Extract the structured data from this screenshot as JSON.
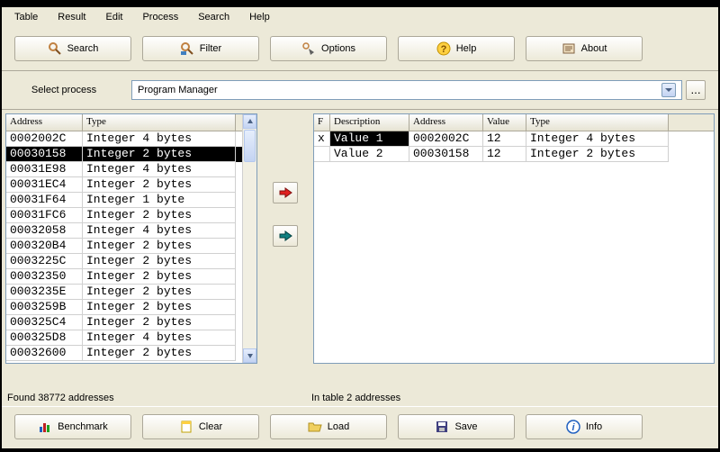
{
  "menu": [
    "Table",
    "Result",
    "Edit",
    "Process",
    "Search",
    "Help"
  ],
  "toolbar": {
    "search": "Search",
    "filter": "Filter",
    "options": "Options",
    "help": "Help",
    "about": "About"
  },
  "process": {
    "label": "Select process",
    "value": "Program Manager",
    "browse": "..."
  },
  "left_grid": {
    "headers": {
      "address": "Address",
      "type": "Type"
    },
    "rows": [
      {
        "addr": "0002002C",
        "type": "Integer 4 bytes",
        "sel": false
      },
      {
        "addr": "00030158",
        "type": "Integer 2 bytes",
        "sel": true
      },
      {
        "addr": "00031E98",
        "type": "Integer 4 bytes",
        "sel": false
      },
      {
        "addr": "00031EC4",
        "type": "Integer 2 bytes",
        "sel": false
      },
      {
        "addr": "00031F64",
        "type": "Integer 1 byte",
        "sel": false
      },
      {
        "addr": "00031FC6",
        "type": "Integer 2 bytes",
        "sel": false
      },
      {
        "addr": "00032058",
        "type": "Integer 4 bytes",
        "sel": false
      },
      {
        "addr": "000320B4",
        "type": "Integer 2 bytes",
        "sel": false
      },
      {
        "addr": "0003225C",
        "type": "Integer 2 bytes",
        "sel": false
      },
      {
        "addr": "00032350",
        "type": "Integer 2 bytes",
        "sel": false
      },
      {
        "addr": "0003235E",
        "type": "Integer 2 bytes",
        "sel": false
      },
      {
        "addr": "0003259B",
        "type": "Integer 2 bytes",
        "sel": false
      },
      {
        "addr": "000325C4",
        "type": "Integer 2 bytes",
        "sel": false
      },
      {
        "addr": "000325D8",
        "type": "Integer 4 bytes",
        "sel": false
      },
      {
        "addr": "00032600",
        "type": "Integer 2 bytes",
        "sel": false
      }
    ]
  },
  "right_grid": {
    "headers": {
      "f": "F",
      "desc": "Description",
      "addr": "Address",
      "value": "Value",
      "type": "Type"
    },
    "rows": [
      {
        "f": "x",
        "desc": "Value 1",
        "addr": "0002002C",
        "val": "12",
        "type": "Integer 4 bytes",
        "sel": true
      },
      {
        "f": "",
        "desc": "Value 2",
        "addr": "00030158",
        "val": "12",
        "type": "Integer 2 bytes",
        "sel": false
      }
    ]
  },
  "status": {
    "left": "Found 38772 addresses",
    "right": "In table 2 addresses"
  },
  "bottom": {
    "benchmark": "Benchmark",
    "clear": "Clear",
    "load": "Load",
    "save": "Save",
    "info": "Info"
  }
}
